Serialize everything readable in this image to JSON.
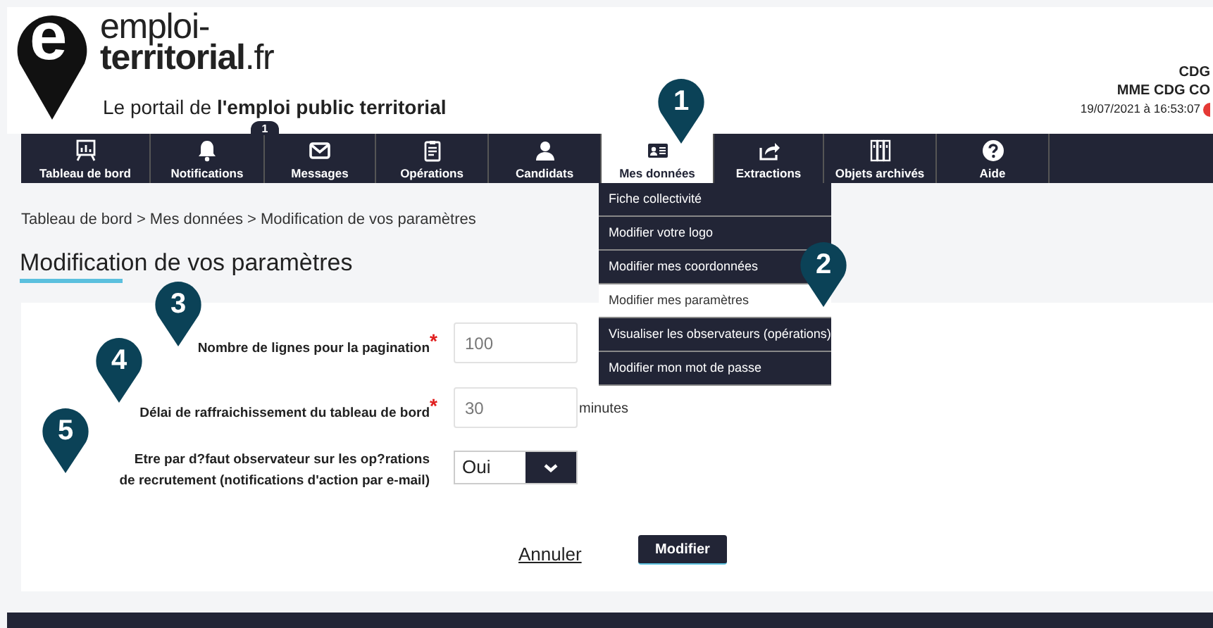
{
  "header": {
    "logo": {
      "mark": "e",
      "line1": "emploi-",
      "line2": "territorial",
      "suffix": ".fr"
    },
    "tagline": "Le portail de **l'emploi public territorial**",
    "user": {
      "organisation": "CDG",
      "name": "MME CDG CO",
      "timestamp": "19/07/2021 à 16:53:07"
    }
  },
  "nav": [
    {
      "label": "Tableau de bord",
      "selected": false
    },
    {
      "label": "Notifications",
      "selected": false,
      "badge": "1"
    },
    {
      "label": "Messages",
      "selected": false
    },
    {
      "label": "Opérations",
      "selected": false
    },
    {
      "label": "Candidats",
      "selected": false
    },
    {
      "label": "Mes données",
      "selected": true
    },
    {
      "label": "Extractions",
      "selected": false
    },
    {
      "label": "Objets archivés",
      "selected": false
    },
    {
      "label": "Aide",
      "selected": false
    }
  ],
  "dropdown": [
    {
      "label": "Fiche collectivité",
      "selected": false
    },
    {
      "label": "Modifier votre logo",
      "selected": false
    },
    {
      "label": "Modifier mes coordonnées",
      "selected": false
    },
    {
      "label": "Modifier mes paramètres",
      "selected": true
    },
    {
      "label": "Visualiser les observateurs (opérations)",
      "selected": false
    },
    {
      "label": "Modifier mon mot de passe",
      "selected": false
    }
  ],
  "breadcrumb": "Tableau de bord > Mes données > Modification de vos paramètres",
  "page_title": "Modification de vos paramètres",
  "form": {
    "fields": [
      {
        "kind": "text",
        "label": "Nombre de lignes pour la pagination",
        "required_mark": "*",
        "value": "100"
      },
      {
        "kind": "text",
        "label": "Délai de raffraichissement du tableau de bord",
        "required_mark": "*",
        "value": "30",
        "unit": "minutes"
      },
      {
        "kind": "select",
        "label": "Etre par d?faut observateur sur les op?rations de recrutement (notifications d'action par e-mail)",
        "value": "Oui"
      }
    ]
  },
  "actions": {
    "cancel": "Annuler",
    "submit": "Modifier"
  },
  "callouts": [
    "1",
    "2",
    "3",
    "4",
    "5"
  ]
}
